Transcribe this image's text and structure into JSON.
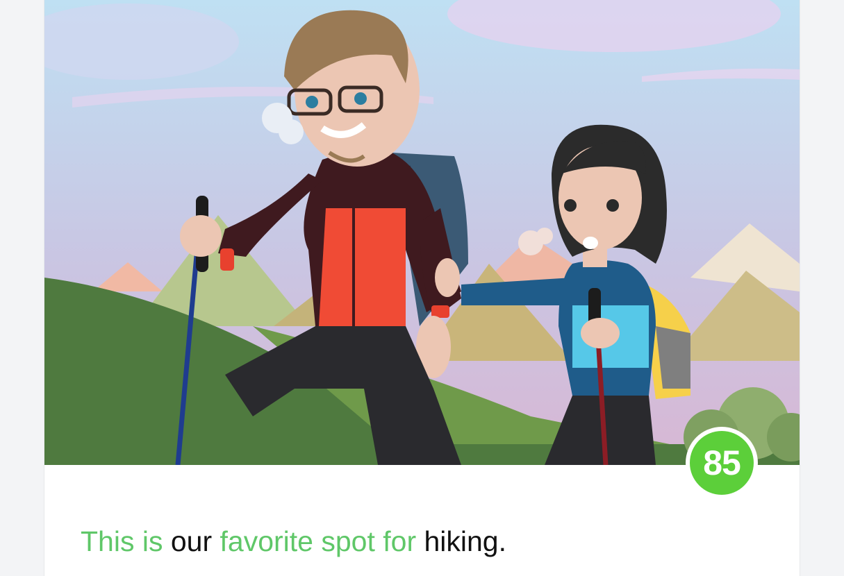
{
  "card": {
    "score": "85",
    "caption_parts": [
      {
        "text": "This is",
        "highlight": true
      },
      {
        "text": " our ",
        "highlight": false
      },
      {
        "text": "favorite spot for",
        "highlight": true
      },
      {
        "text": " hiking.",
        "highlight": false
      }
    ]
  },
  "colors": {
    "highlight": "#5fc768",
    "badge": "#5ccf3a",
    "text": "#111111"
  },
  "icons": [
    "hikers-illustration"
  ]
}
